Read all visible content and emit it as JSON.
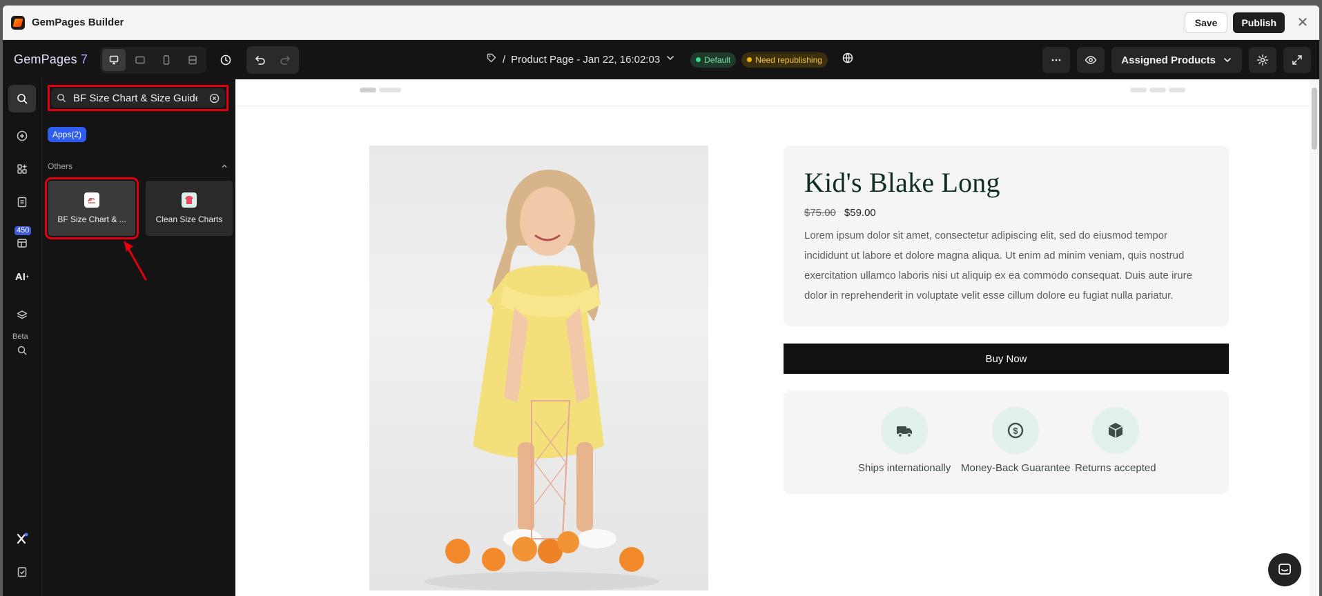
{
  "window": {
    "title": "GemPages Builder",
    "save_label": "Save",
    "publish_label": "Publish",
    "close_glyph": "✕"
  },
  "topbar": {
    "logo_text": "GemPages",
    "logo_version": "7",
    "devices": [
      "desktop-icon",
      "tablet-landscape-icon",
      "mobile-icon",
      "responsive-icon"
    ],
    "page_prefix": "/",
    "page_name": "Product Page - Jan 22, 16:02:03",
    "badge_default": "Default",
    "badge_warning": "Need republishing",
    "assigned_label": "Assigned Products",
    "colors": {
      "accent": "#2f5df0",
      "warning": "#f4b400",
      "success": "#3ddc84"
    }
  },
  "rail": {
    "badge_count": "450",
    "ai_label": "AI",
    "beta_label": "Beta"
  },
  "panel": {
    "search_value": "BF Size Chart & Size Guide",
    "apps_chip": "Apps(2)",
    "section_title": "Others",
    "tiles": [
      {
        "label": "BF Size Chart & ...",
        "icon": "bf-size-chart-icon"
      },
      {
        "label": "Clean Size Charts",
        "icon": "clean-size-charts-icon"
      }
    ],
    "highlight_color": "#e0000e"
  },
  "product": {
    "title": "Kid's Blake Long",
    "old_price": "$75.00",
    "price": "$59.00",
    "description": "Lorem ipsum dolor sit amet, consectetur adipiscing elit, sed do eiusmod tempor incididunt ut labore et dolore magna aliqua. Ut enim ad minim veniam, quis nostrud exercitation ullamco laboris nisi ut aliquip ex ea commodo consequat. Duis aute irure dolor in reprehenderit in voluptate velit esse cillum dolore eu fugiat nulla pariatur.",
    "buy_label": "Buy Now",
    "features": [
      {
        "label": "Ships internationally",
        "icon": "truck-icon"
      },
      {
        "label": "Money-Back Guarantee",
        "icon": "money-back-icon"
      },
      {
        "label": "Returns accepted",
        "icon": "box-icon"
      }
    ]
  }
}
